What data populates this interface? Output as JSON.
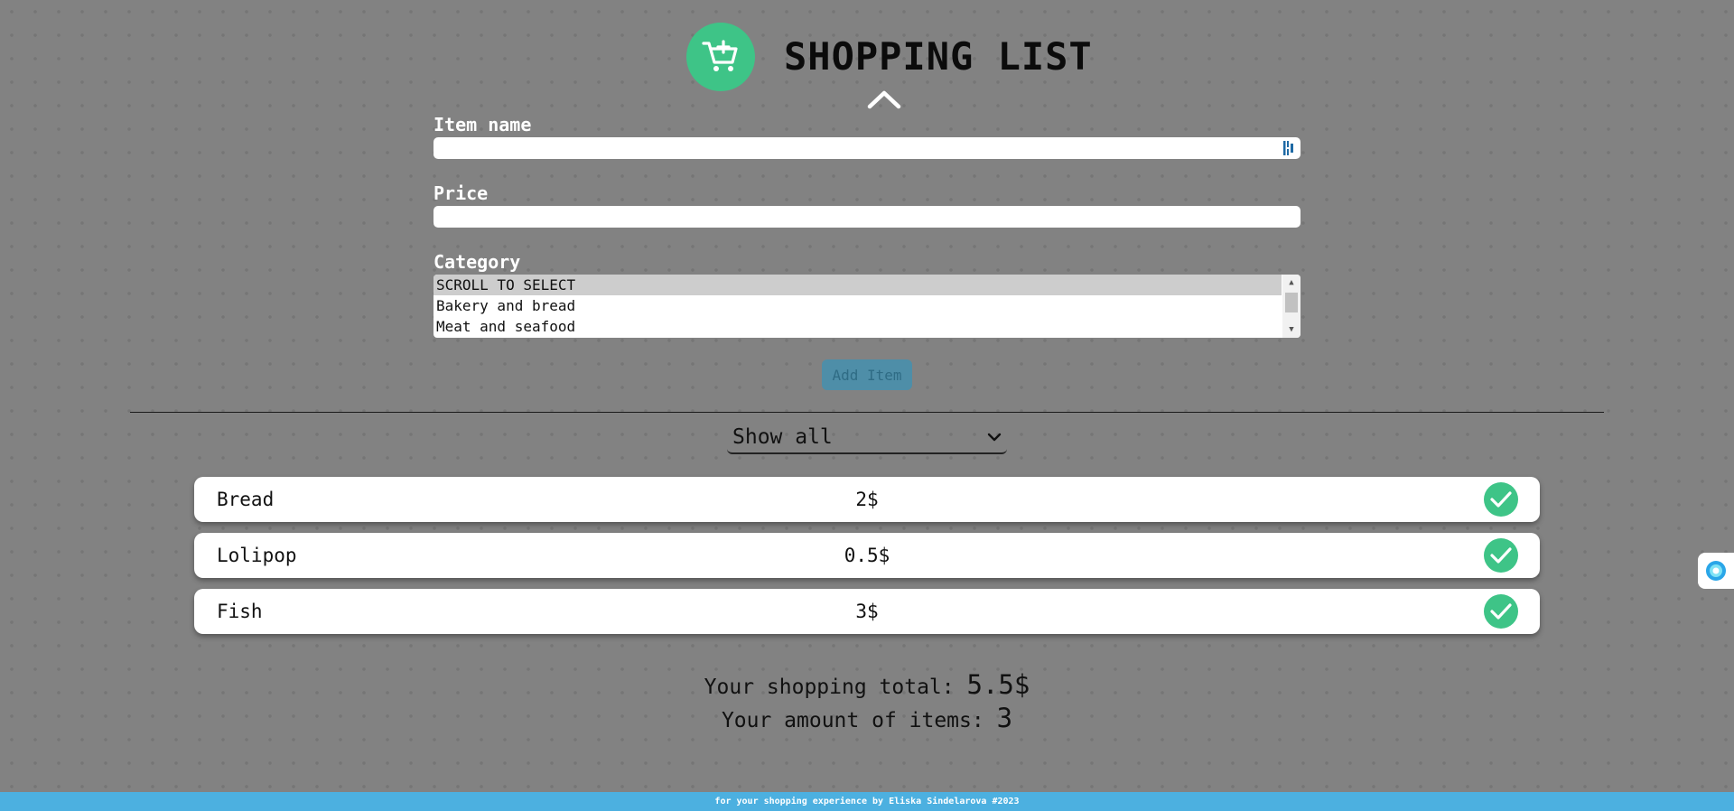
{
  "header": {
    "title": "SHOPPING LIST",
    "logo_icon": "cart-plus-icon",
    "collapse_icon": "chevron-up-icon"
  },
  "form": {
    "item_name_label": "Item name",
    "item_name_value": "",
    "price_label": "Price",
    "price_value": "",
    "category_label": "Category",
    "category_options": [
      "SCROLL TO SELECT",
      "Bakery and bread",
      "Meat and seafood"
    ],
    "add_button_label": "Add Item"
  },
  "filter": {
    "selected": "Show all",
    "icon": "chevron-down-icon"
  },
  "items": [
    {
      "name": "Bread",
      "price": "2$"
    },
    {
      "name": "Lolipop",
      "price": "0.5$"
    },
    {
      "name": "Fish",
      "price": "3$"
    }
  ],
  "totals": {
    "total_label": "Your shopping total:",
    "total_value": "5.5$",
    "count_label": "Your amount of items:",
    "count_value": "3"
  },
  "footer": {
    "text": "for your shopping experience by Eliska Sindelarova #2023"
  },
  "colors": {
    "accent_green": "#3ec487",
    "footer_blue": "#4cb0e0",
    "background": "#828282"
  }
}
